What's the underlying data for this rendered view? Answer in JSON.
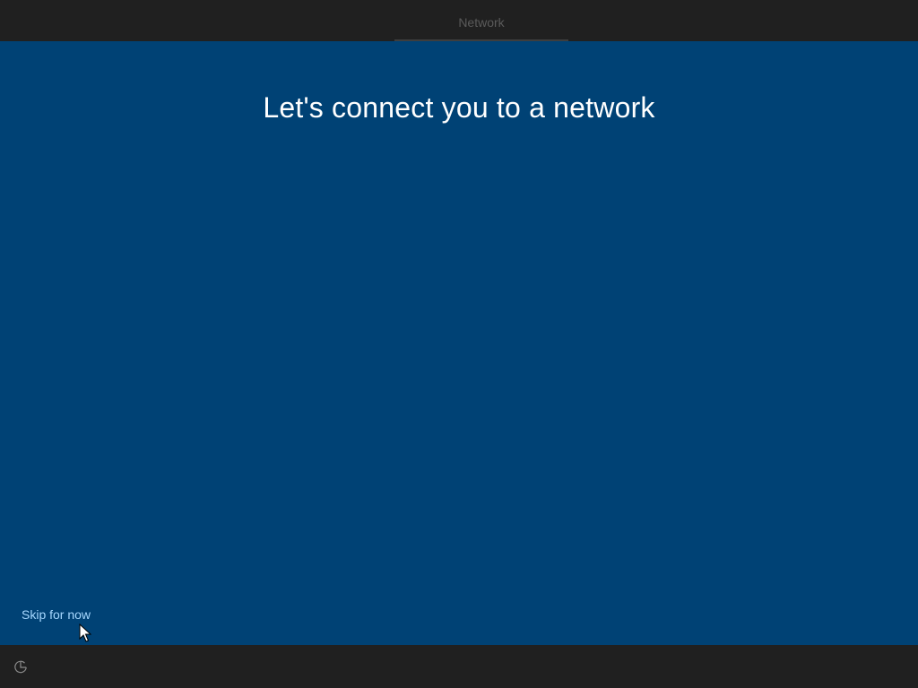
{
  "header": {
    "step_label": "Network"
  },
  "main": {
    "title": "Let's connect you to a network",
    "skip_label": "Skip for now"
  },
  "footer": {
    "icon": "ease-of-access-icon"
  },
  "colors": {
    "background": "#004275",
    "bars": "#202020",
    "title": "#ffffff",
    "link": "#a6d8ff",
    "tab_text": "#5a5a5a"
  }
}
